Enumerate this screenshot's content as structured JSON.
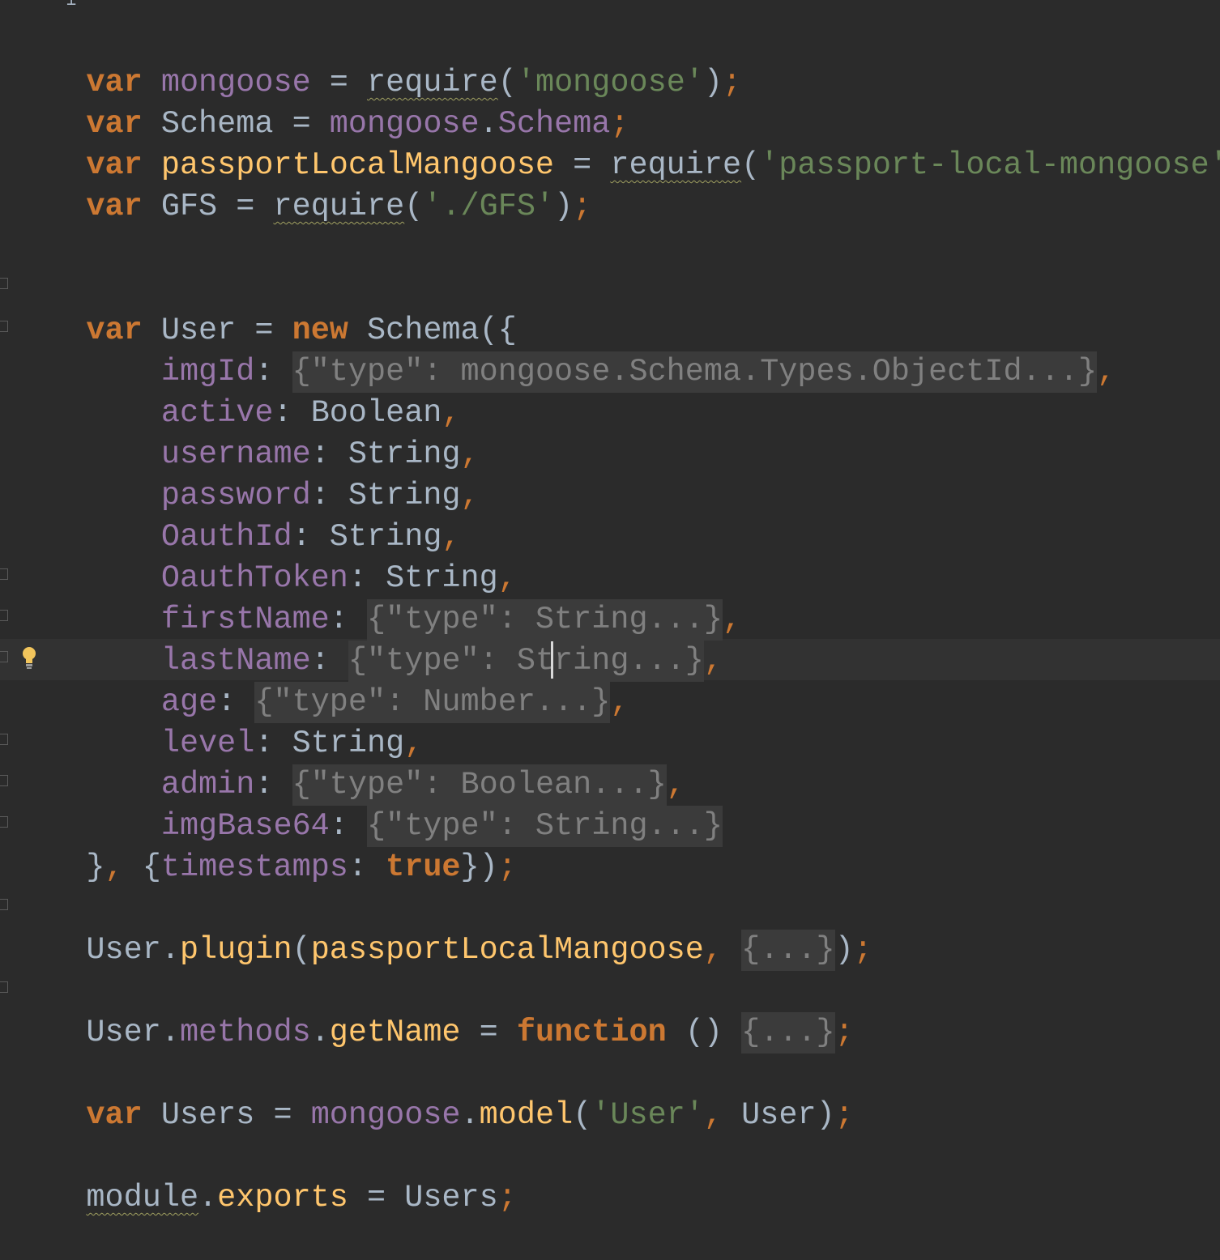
{
  "editor": {
    "lines": {
      "l1": {
        "kw": "var",
        "name": "mongoose",
        "eq": "=",
        "fn": "require",
        "open": "(",
        "str": "'mongoose'",
        "close": ")",
        "semi": ";"
      },
      "l2": {
        "kw": "var",
        "name": "Schema",
        "eq": "=",
        "obj": "mongoose",
        "dot": ".",
        "prop": "Schema",
        "semi": ";"
      },
      "l3": {
        "kw": "var",
        "name": "passportLocalMangoose",
        "eq": "=",
        "fn": "require",
        "open": "(",
        "str": "'passport-local-mongoose'",
        "close": ")",
        "semi": ";"
      },
      "l4": {
        "kw": "var",
        "name": "GFS",
        "eq": "=",
        "fn": "require",
        "open": "(",
        "str": "'./GFS'",
        "close": ")",
        "semi": ";"
      },
      "l5": {
        "kw": "var",
        "name": "User",
        "eq": "=",
        "kw2": "new",
        "cls": "Schema",
        "open": "({"
      },
      "l6": {
        "prop": "imgId",
        "colon": ":",
        "fold": "{\"type\": mongoose.Schema.Types.ObjectId...}",
        "comma": ","
      },
      "l7": {
        "prop": "active",
        "colon": ":",
        "type": "Boolean",
        "comma": ","
      },
      "l8": {
        "prop": "username",
        "colon": ":",
        "type": "String",
        "comma": ","
      },
      "l9": {
        "prop": "password",
        "colon": ":",
        "type": "String",
        "comma": ","
      },
      "l10": {
        "prop": "OauthId",
        "colon": ":",
        "type": "String",
        "comma": ","
      },
      "l11": {
        "prop": "OauthToken",
        "colon": ":",
        "type": "String",
        "comma": ","
      },
      "l12": {
        "prop": "firstName",
        "colon": ":",
        "fold": "{\"type\": String...}",
        "comma": ","
      },
      "l13": {
        "prop": "lastName",
        "colon": ":",
        "fold": "{\"type\": String...}",
        "comma": ","
      },
      "l14": {
        "prop": "age",
        "colon": ":",
        "fold": "{\"type\": Number...}",
        "comma": ","
      },
      "l15": {
        "prop": "level",
        "colon": ":",
        "type": "String",
        "comma": ","
      },
      "l16": {
        "prop": "admin",
        "colon": ":",
        "fold": "{\"type\": Boolean...}",
        "comma": ","
      },
      "l17": {
        "prop": "imgBase64",
        "colon": ":",
        "fold": "{\"type\": String...}"
      },
      "l18": {
        "close": "}",
        "comma": ",",
        "open2": "{",
        "prop": "timestamps",
        "colon": ":",
        "kw": "true",
        "close2": "})",
        "semi": ";"
      },
      "l19": {
        "obj": "User",
        "dot": ".",
        "fn": "plugin",
        "open": "(",
        "arg": "passportLocalMangoose",
        "comma": ",",
        "fold": "{...}",
        "close": ")",
        "semi": ";"
      },
      "l20": {
        "obj": "User",
        "dot": ".",
        "prop": "methods",
        "dot2": ".",
        "fn": "getName",
        "eq": "=",
        "kw": "function",
        "parens": "()",
        "fold": "{...}",
        "semi": ";"
      },
      "l21": {
        "kw": "var",
        "name": "Users",
        "eq": "=",
        "obj": "mongoose",
        "dot": ".",
        "fn": "model",
        "open": "(",
        "str": "'User'",
        "comma": ",",
        "arg": "User",
        "close": ")",
        "semi": ";"
      },
      "l22": {
        "obj": "module",
        "dot": ".",
        "fn": "exports",
        "eq": "=",
        "arg": "Users",
        "semi": ";"
      }
    },
    "colors": {
      "background": "#2b2b2b",
      "keyword": "#cc7832",
      "string": "#6a8759",
      "property": "#9876aa",
      "function": "#ffc66d",
      "text": "#a9b7c6",
      "fold": "#3b3b3b"
    },
    "icons": {
      "intention": "lightbulb-icon"
    }
  }
}
